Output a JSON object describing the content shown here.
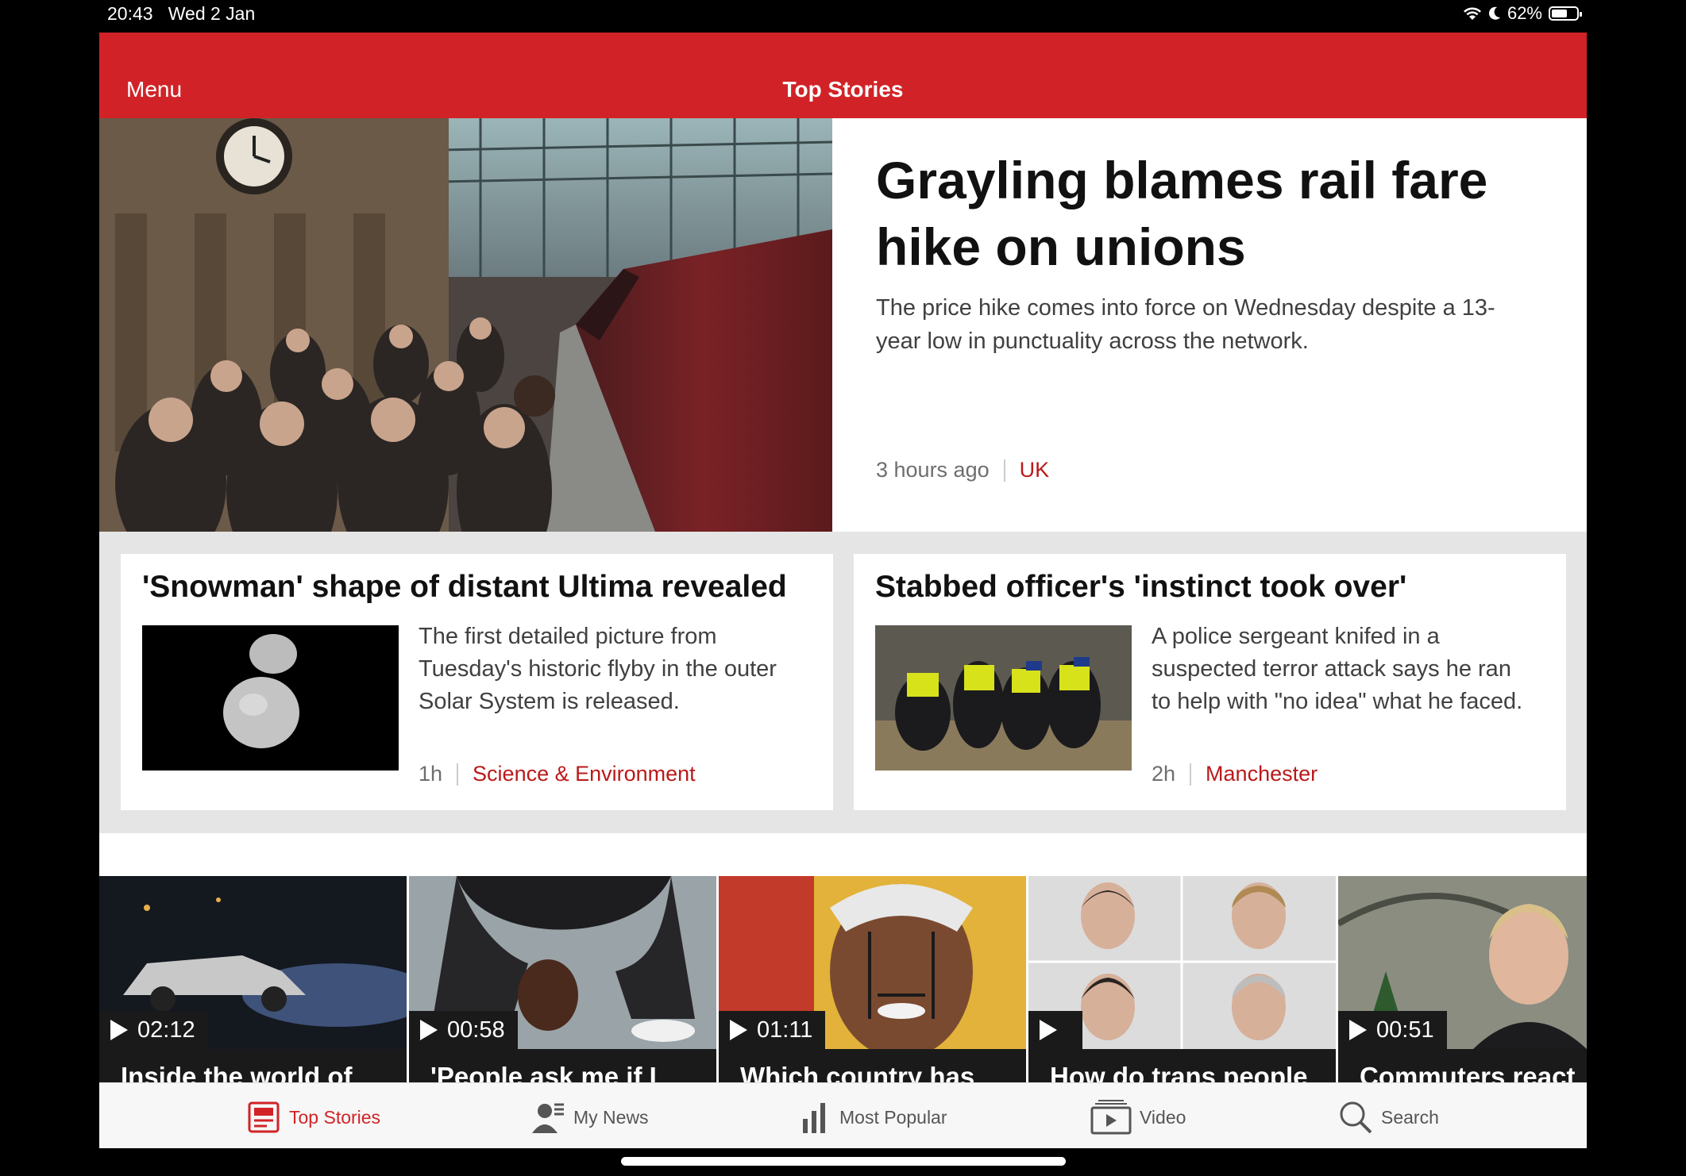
{
  "status_bar": {
    "time": "20:43",
    "date": "Wed 2 Jan",
    "battery": "62%",
    "battery_level": 0.62
  },
  "header": {
    "menu_label": "Menu",
    "title": "Top Stories"
  },
  "hero": {
    "headline": "Grayling blames rail fare hike on unions",
    "summary": "The price hike comes into force on Wednesday despite a 13-year low in punctuality across the network.",
    "time": "3 hours ago",
    "category": "UK",
    "image_icon": "train-station-photo"
  },
  "stories": [
    {
      "headline": "'Snowman' shape of distant Ultima revealed",
      "summary": "The first detailed picture from Tuesday's historic flyby in the outer Solar System is released.",
      "time": "1h",
      "category": "Science & Environment"
    },
    {
      "headline": "Stabbed officer's 'instinct took over'",
      "summary": "A police sergeant knifed in a suspected terror attack says he ran to help with \"no idea\" what he faced.",
      "time": "2h",
      "category": "Manchester"
    }
  ],
  "videos": [
    {
      "duration": "02:12",
      "title": "Inside the world of"
    },
    {
      "duration": "00:58",
      "title": "'People ask me if I"
    },
    {
      "duration": "01:11",
      "title": "Which country has"
    },
    {
      "duration": "",
      "title": "How do trans people"
    },
    {
      "duration": "00:51",
      "title": "Commuters react"
    }
  ],
  "tabs": [
    {
      "label": "Top Stories",
      "icon": "top-stories-icon",
      "active": true
    },
    {
      "label": "My News",
      "icon": "my-news-icon"
    },
    {
      "label": "Most Popular",
      "icon": "most-popular-icon"
    },
    {
      "label": "Video",
      "icon": "video-icon"
    },
    {
      "label": "Search",
      "icon": "search-icon"
    }
  ],
  "colors": {
    "brand_red": "#d12327",
    "category_red": "#bb1919"
  }
}
